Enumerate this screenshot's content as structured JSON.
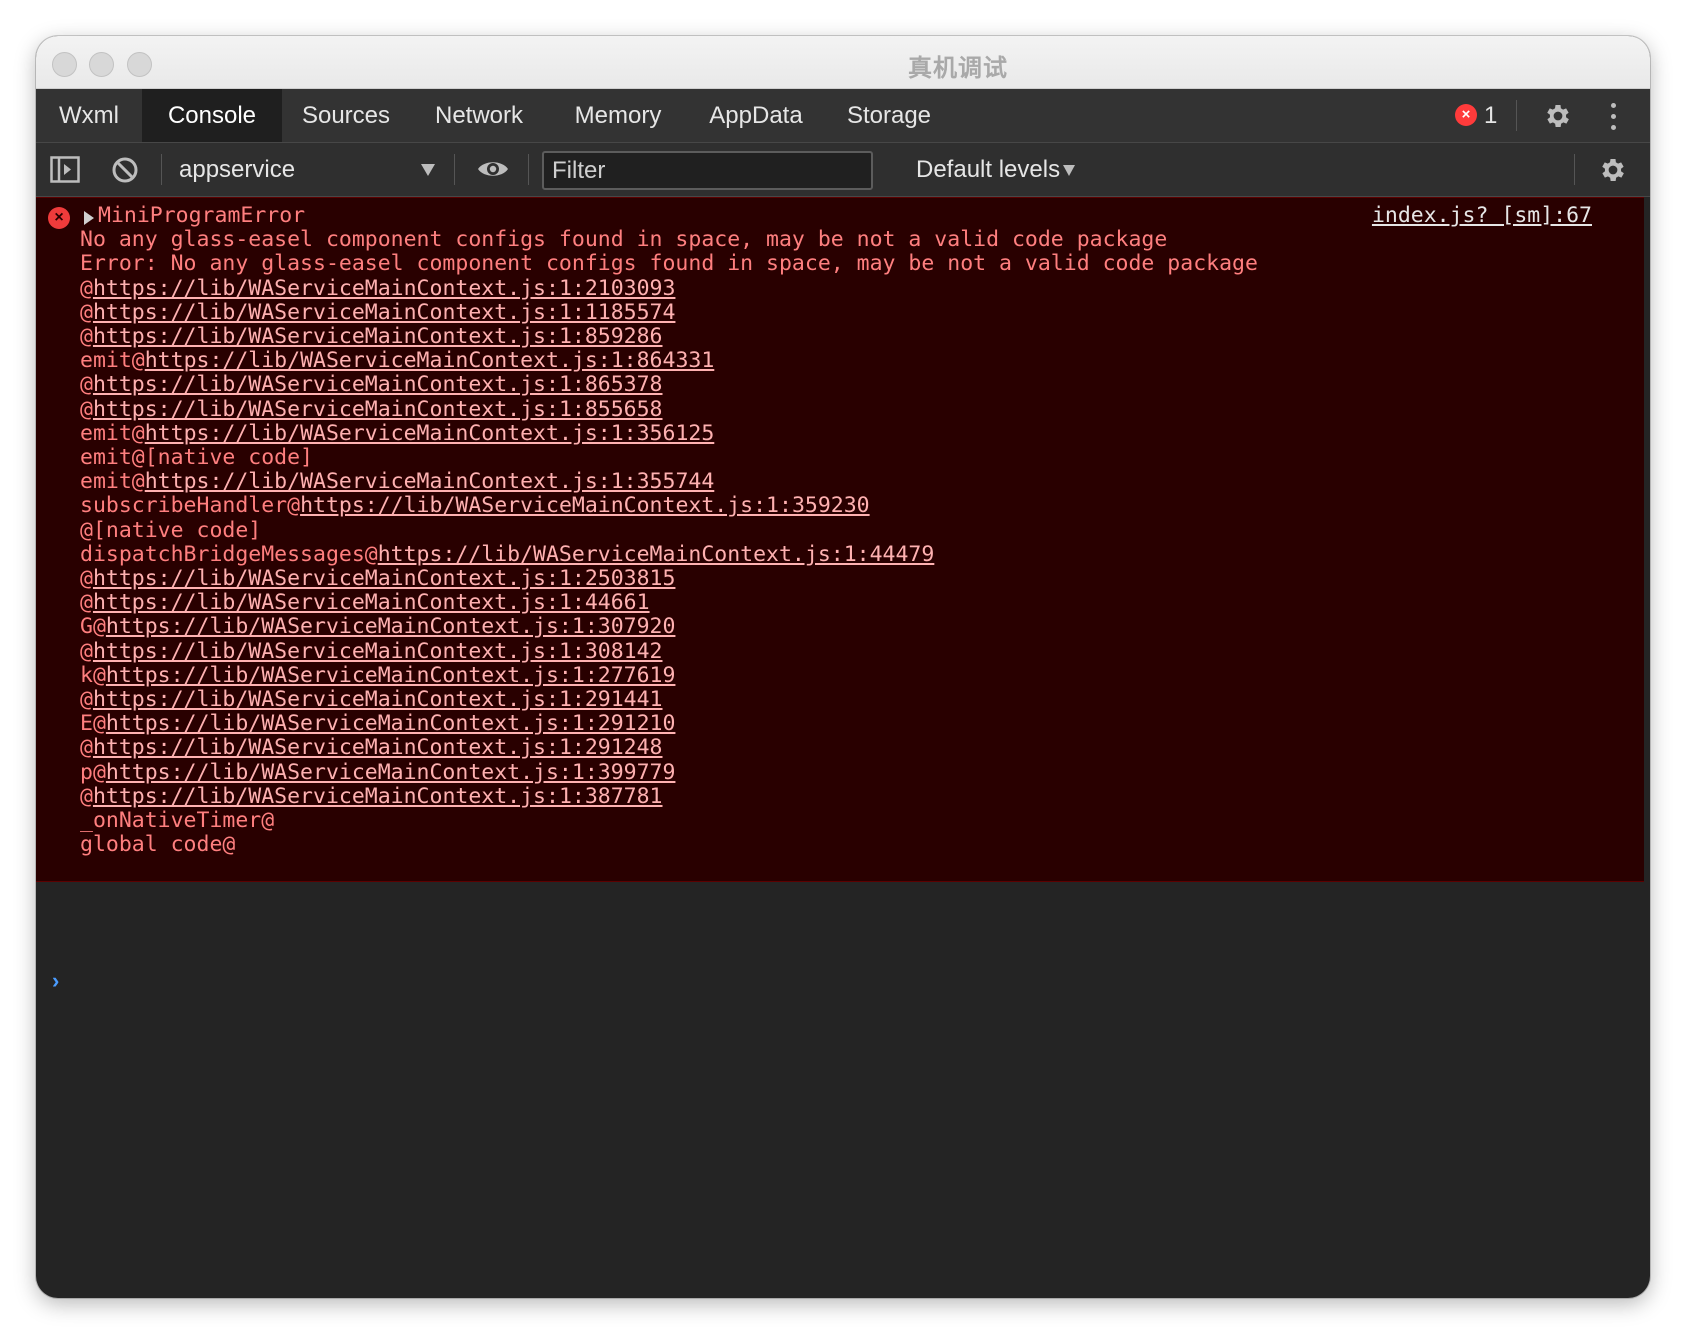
{
  "window": {
    "title": "真机调试"
  },
  "tabs": [
    {
      "label": "Wxml",
      "active": false
    },
    {
      "label": "Console",
      "active": true
    },
    {
      "label": "Sources",
      "active": false
    },
    {
      "label": "Network",
      "active": false
    },
    {
      "label": "Memory",
      "active": false
    },
    {
      "label": "AppData",
      "active": false
    },
    {
      "label": "Storage",
      "active": false
    }
  ],
  "status": {
    "error_count": "1",
    "error_badge_icon": "×"
  },
  "toolbar": {
    "context": "appservice",
    "filter_placeholder": "Filter",
    "levels": "Default levels"
  },
  "error": {
    "title": "MiniProgramError",
    "source": "index.js? [sm]:67",
    "lines": [
      {
        "prefix": "No any glass-easel component configs found in space, may be not a valid code package",
        "url": ""
      },
      {
        "prefix": "Error: No any glass-easel component configs found in space, may be not a valid code package",
        "url": ""
      },
      {
        "prefix": "@",
        "url": "https://lib/WAServiceMainContext.js:1:2103093"
      },
      {
        "prefix": "@",
        "url": "https://lib/WAServiceMainContext.js:1:1185574"
      },
      {
        "prefix": "@",
        "url": "https://lib/WAServiceMainContext.js:1:859286"
      },
      {
        "prefix": "emit@",
        "url": "https://lib/WAServiceMainContext.js:1:864331"
      },
      {
        "prefix": "@",
        "url": "https://lib/WAServiceMainContext.js:1:865378"
      },
      {
        "prefix": "@",
        "url": "https://lib/WAServiceMainContext.js:1:855658"
      },
      {
        "prefix": "emit@",
        "url": "https://lib/WAServiceMainContext.js:1:356125"
      },
      {
        "prefix": "emit@[native code]",
        "url": ""
      },
      {
        "prefix": "emit@",
        "url": "https://lib/WAServiceMainContext.js:1:355744"
      },
      {
        "prefix": "subscribeHandler@",
        "url": "https://lib/WAServiceMainContext.js:1:359230"
      },
      {
        "prefix": "@[native code]",
        "url": ""
      },
      {
        "prefix": "dispatchBridgeMessages@",
        "url": "https://lib/WAServiceMainContext.js:1:44479"
      },
      {
        "prefix": "@",
        "url": "https://lib/WAServiceMainContext.js:1:2503815"
      },
      {
        "prefix": "@",
        "url": "https://lib/WAServiceMainContext.js:1:44661"
      },
      {
        "prefix": "G@",
        "url": "https://lib/WAServiceMainContext.js:1:307920"
      },
      {
        "prefix": "@",
        "url": "https://lib/WAServiceMainContext.js:1:308142"
      },
      {
        "prefix": "k@",
        "url": "https://lib/WAServiceMainContext.js:1:277619"
      },
      {
        "prefix": "@",
        "url": "https://lib/WAServiceMainContext.js:1:291441"
      },
      {
        "prefix": "E@",
        "url": "https://lib/WAServiceMainContext.js:1:291210"
      },
      {
        "prefix": "@",
        "url": "https://lib/WAServiceMainContext.js:1:291248"
      },
      {
        "prefix": "p@",
        "url": "https://lib/WAServiceMainContext.js:1:399779"
      },
      {
        "prefix": "@",
        "url": "https://lib/WAServiceMainContext.js:1:387781"
      },
      {
        "prefix": "_onNativeTimer@",
        "url": ""
      },
      {
        "prefix": "global code@",
        "url": ""
      }
    ]
  },
  "console": {
    "prompt": "›"
  },
  "colors": {
    "error_text": "#ff7f7f",
    "error_bg": "#290000",
    "prompt": "#4a9cff",
    "badge": "#ff3b3b"
  }
}
